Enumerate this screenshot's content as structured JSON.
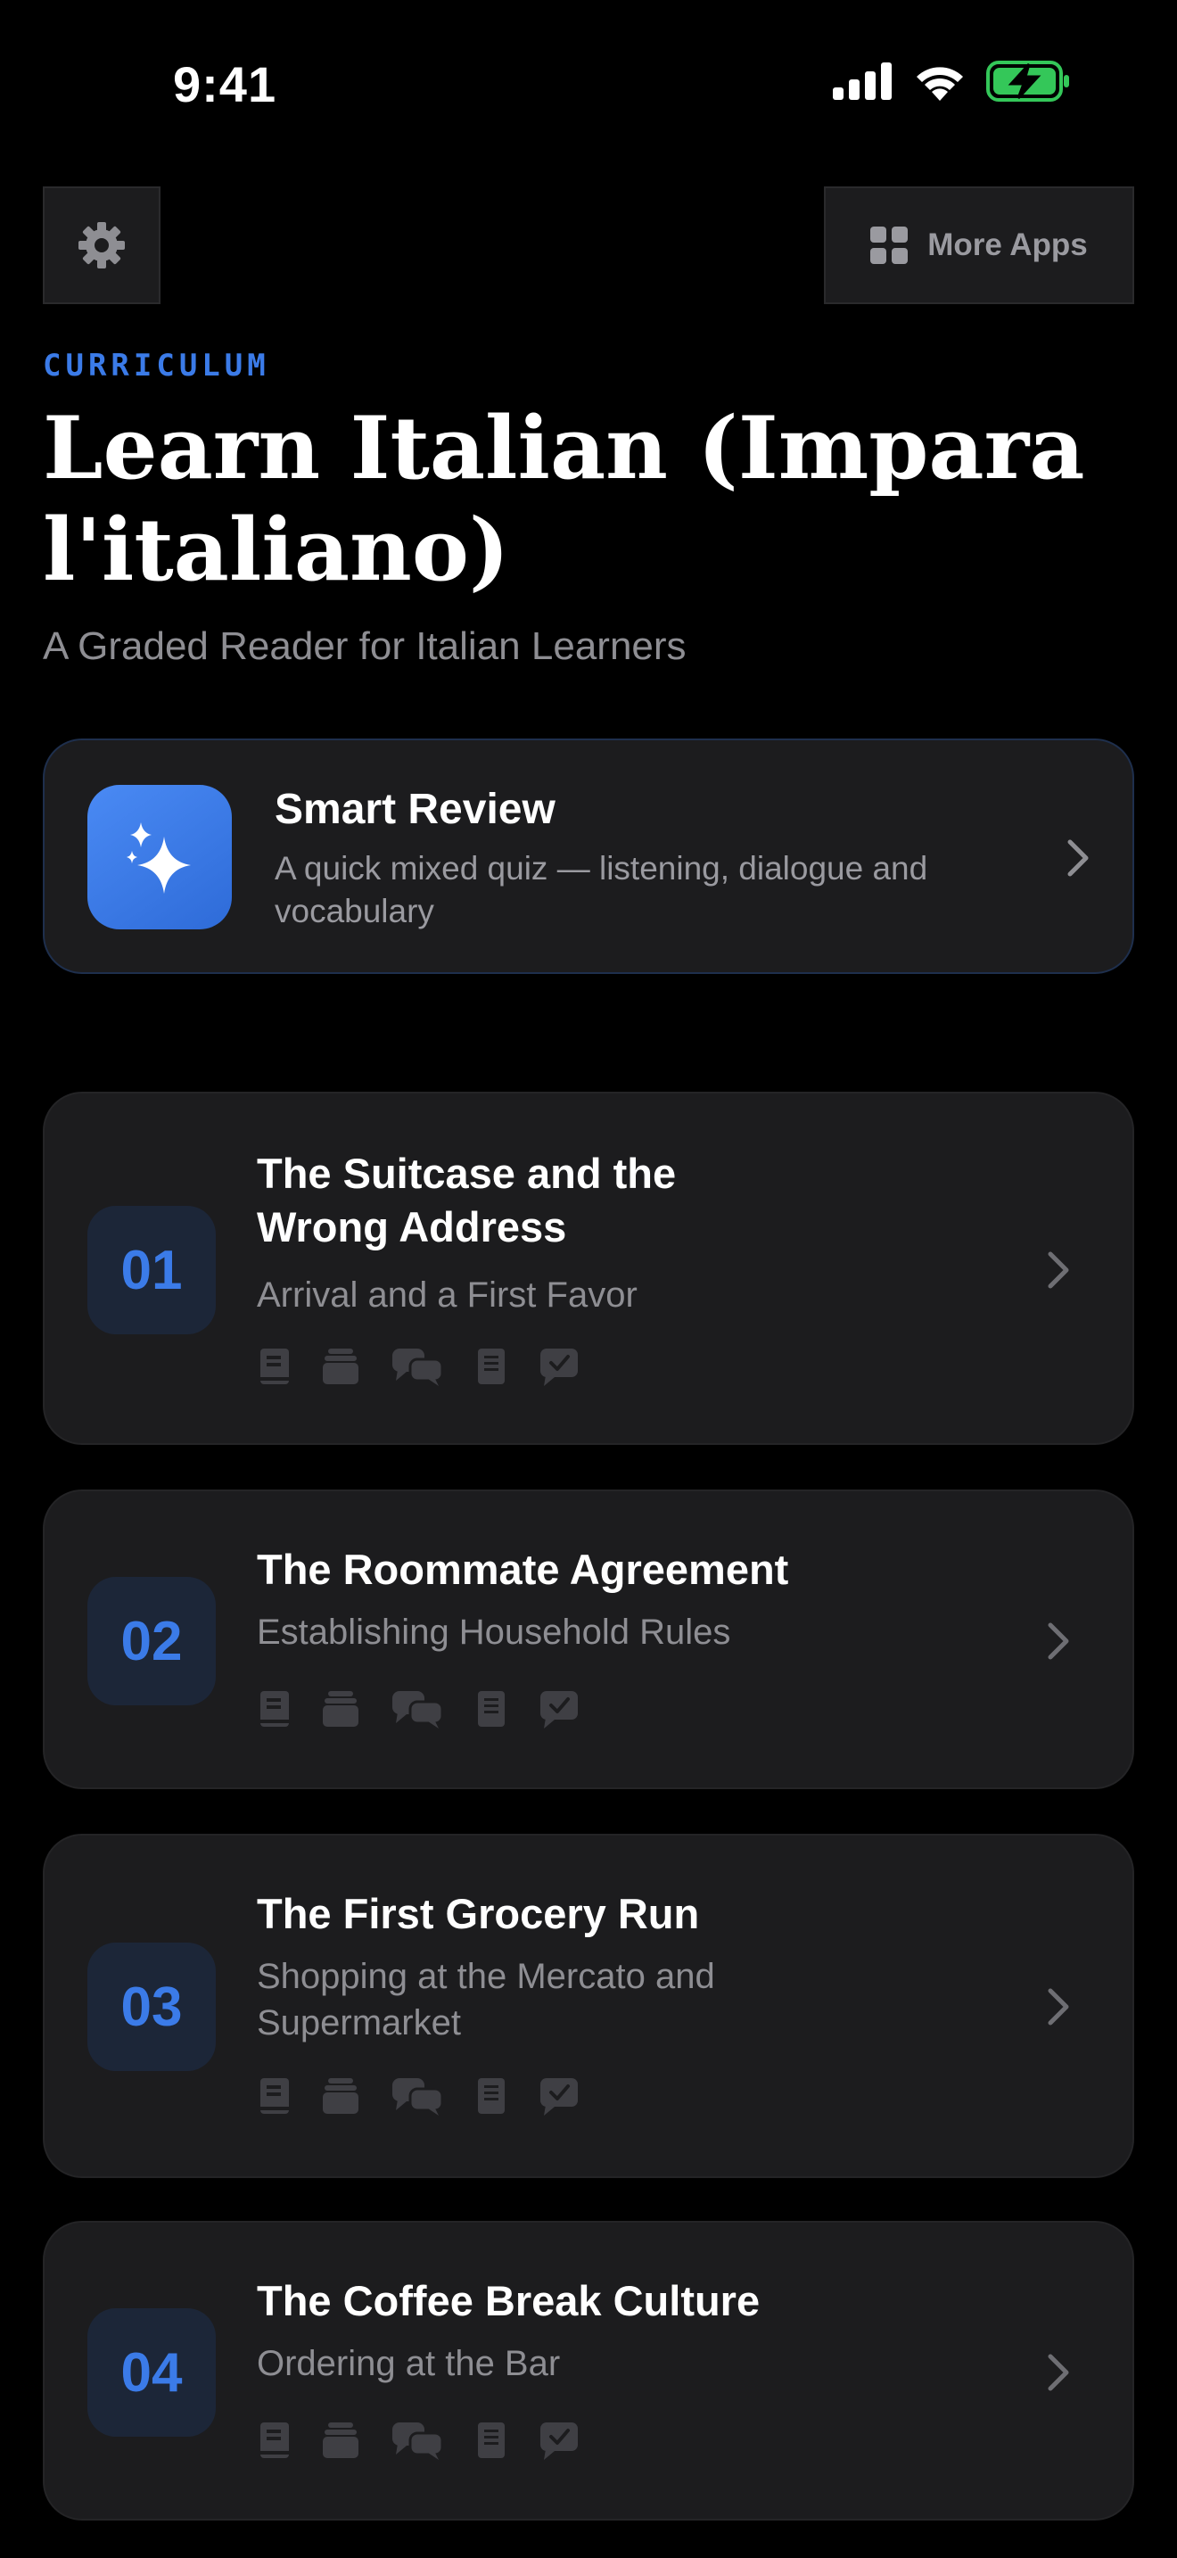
{
  "status_bar": {
    "time": "9:41"
  },
  "header": {
    "more_apps_label": "More Apps",
    "eyebrow": "CURRICULUM",
    "title": "Learn Italian (Impara l'italiano)",
    "subtitle": "A Graded Reader for Italian Learners"
  },
  "smart_review": {
    "title": "Smart Review",
    "description": "A quick mixed quiz — listening, dialogue and vocabulary"
  },
  "lessons": [
    {
      "number": "01",
      "title": "The Suitcase and the Wrong Address",
      "subtitle": "Arrival and a First Favor"
    },
    {
      "number": "02",
      "title": "The Roommate Agreement",
      "subtitle": "Establishing Household Rules"
    },
    {
      "number": "03",
      "title": "The First Grocery Run",
      "subtitle": "Shopping at the Mercato and Supermarket"
    },
    {
      "number": "04",
      "title": "The Coffee Break Culture",
      "subtitle": "Ordering at the Bar"
    }
  ],
  "lesson_activity_icons": [
    "book-icon",
    "flashcards-icon",
    "dialogue-icon",
    "document-icon",
    "quiz-check-icon"
  ],
  "colors": {
    "accent": "#3b7be8",
    "background": "#000000",
    "card": "#1c1c1e",
    "battery": "#34c759"
  }
}
